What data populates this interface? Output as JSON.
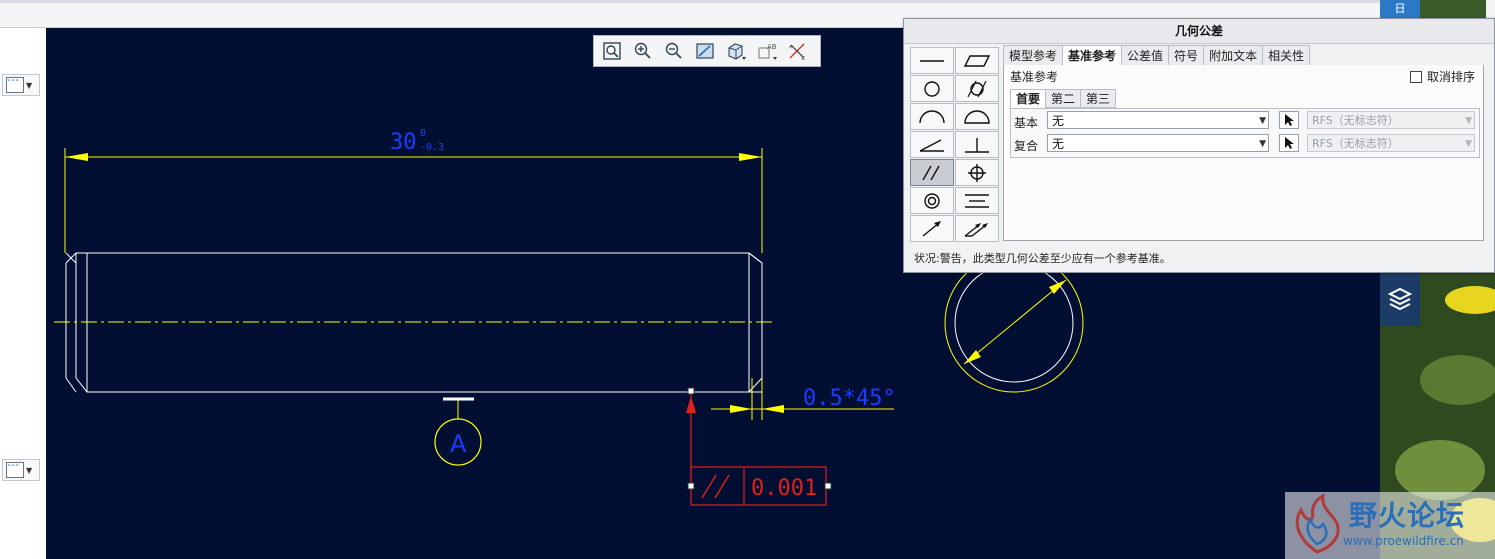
{
  "dialog": {
    "title": "几何公差",
    "tabs": [
      "模型参考",
      "基准参考",
      "公差值",
      "符号",
      "附加文本",
      "相关性"
    ],
    "active_tab": "基准参考",
    "section_title": "基准参考",
    "unsort_label": "取消排序",
    "subtabs": [
      "首要",
      "第二",
      "第三"
    ],
    "rows": [
      {
        "label": "基本",
        "value": "无",
        "modifier": "RFS（无标志符）"
      },
      {
        "label": "复合",
        "value": "无",
        "modifier": "RFS（无标志符）"
      }
    ],
    "status": "状况:警告，此类型几何公差至少应有一个参考基准。",
    "symbols": [
      "straightness-icon",
      "flatness-icon",
      "circularity-icon",
      "cylindricity-icon",
      "line-profile-icon",
      "surface-profile-icon",
      "angularity-icon",
      "perpendicularity-icon",
      "parallelism-icon",
      "position-icon",
      "concentricity-icon",
      "symmetry-icon",
      "circular-runout-icon",
      "total-runout-icon"
    ]
  },
  "drawing": {
    "dimension_text": "30",
    "dimension_tol_upper": "0",
    "dimension_tol_lower": "-0.3",
    "chamfer_text": "0.5*45°",
    "datum_label": "A",
    "gtol_value": "0.001",
    "colors": {
      "background": "#020f33",
      "geometry": "#ffffff",
      "dimension": "#ffff00",
      "text": "#1c3cff",
      "gtol": "#e0201a"
    }
  },
  "right_strip": {
    "tab_label": "日"
  },
  "watermark": {
    "name": "野火论坛",
    "url": "www.proewildfire.cn"
  }
}
